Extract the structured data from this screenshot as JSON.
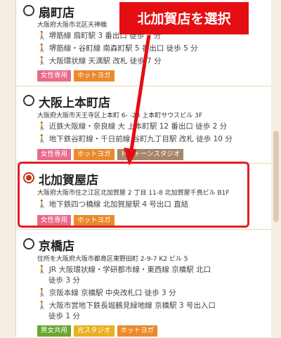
{
  "annotation": {
    "text": "北加賀店を選択"
  },
  "stores": [
    {
      "name": "扇町店",
      "address": "大阪府大阪市北区天神橋",
      "routes": [
        "堺筋線 扇町駅 3 番出口 徒歩 2 分",
        "堺筋線・谷町線 南森町駅 5 番出口 徒歩 5 分",
        "大阪環状線 天満駅 改札 徒歩 7 分"
      ],
      "tags": [
        "女性専用",
        "ホットヨガ"
      ],
      "selected": false
    },
    {
      "name": "大阪上本町店",
      "address": "大阪府大阪市天王寺区上本町 6- -23 上本町サウスビル 3F",
      "routes": [
        "近鉄大阪線・奈良線 大 上本町駅 12 番出口 徒歩 2 分",
        "地下鉄谷町線・千日前線 谷町九丁目駅 改札 徒歩 10 分"
      ],
      "tags": [
        "女性専用",
        "ホットヨガ",
        "ドストーンスタジオ"
      ],
      "selected": false
    },
    {
      "name": "北加賀屋店",
      "address": "大阪府大阪市住之江区北加賀屋 2 丁目 11-8 北加賀屋千鳥ビル B1F",
      "routes": [
        "地下鉄四つ橋線 北加賀屋駅 4 号出口 直結"
      ],
      "tags": [
        "女性専用",
        "ホットヨガ"
      ],
      "selected": true
    },
    {
      "name": "京橋店",
      "address": "住所を大阪府大阪市都島区東野田町 2-9-7 K2 ビル 5",
      "routes": [
        "JR 大阪環状線・学研都市線・東西線 京橋駅 北口",
        "京阪本線 京橋駅 中央改札口 徒歩 3 分",
        "大阪市営地下鉄長堀鶴見緑地線 京橋駅 3 号出入口"
      ],
      "route_continuations": [
        "徒歩 3 分",
        "徒歩 1 分"
      ],
      "tags": [
        "男女共用",
        "光スタジオ",
        "ホットヨガ"
      ],
      "selected": false
    }
  ]
}
